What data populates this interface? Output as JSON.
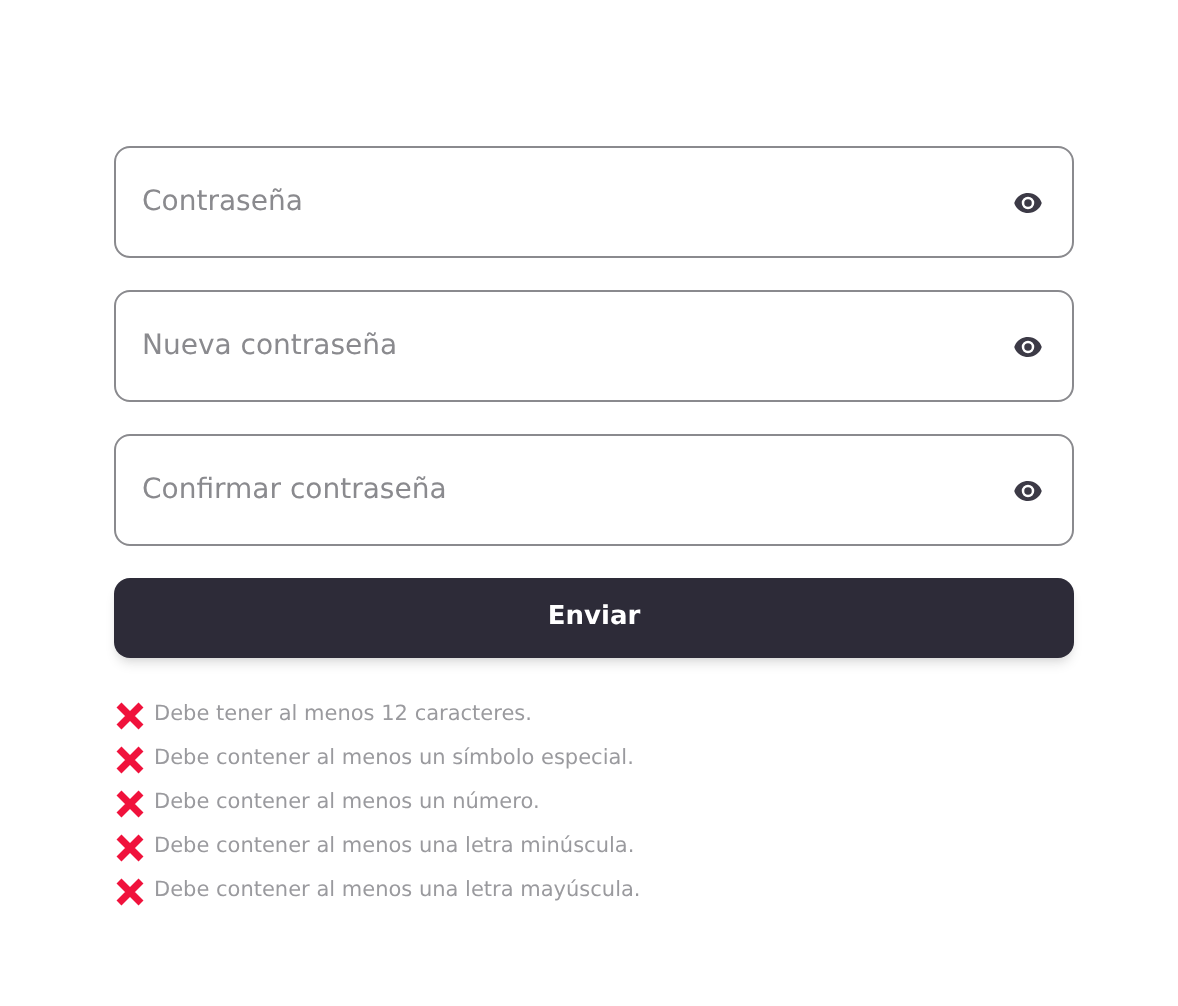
{
  "fields": [
    {
      "placeholder": "Contraseña"
    },
    {
      "placeholder": "Nueva contraseña"
    },
    {
      "placeholder": "Confirmar contraseña"
    }
  ],
  "submit_button": {
    "label": "Enviar"
  },
  "requirements": [
    {
      "text": "Debe tener al menos 12 caracteres.",
      "met": false
    },
    {
      "text": "Debe contener al menos un símbolo especial.",
      "met": false
    },
    {
      "text": "Debe contener al menos un número.",
      "met": false
    },
    {
      "text": "Debe contener al menos una letra minúscula.",
      "met": false
    },
    {
      "text": "Debe contener al menos una letra mayúscula.",
      "met": false
    }
  ]
}
